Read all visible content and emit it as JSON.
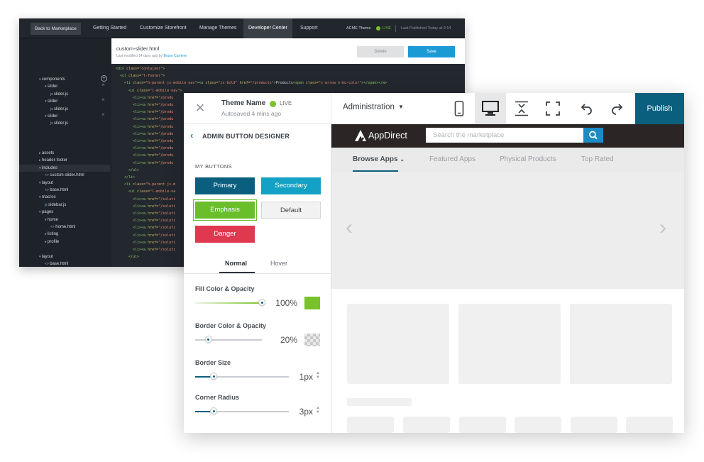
{
  "dev_center": {
    "back_button": "Back to Marketplace",
    "nav": [
      "Getting Started",
      "Customize Storefront",
      "Manage Themes",
      "Developer Center",
      "Support"
    ],
    "active_nav": "Developer Center",
    "theme_name": "ACME Theme",
    "live_label": "LIVE",
    "published": "Last Published Today at 2:14",
    "file": {
      "name": "custom-slider.html",
      "meta_prefix": "Last modified 14 days ago by ",
      "author": "Bruno Carriere",
      "delete_label": "Delete",
      "save_label": "Save"
    },
    "tree": [
      {
        "label": "components",
        "indent": 1,
        "kind": "folder",
        "plus": true
      },
      {
        "label": "slider",
        "indent": 2,
        "kind": "folder",
        "close": true
      },
      {
        "label": "slider.js",
        "indent": 3,
        "kind": "js"
      },
      {
        "label": "slider",
        "indent": 2,
        "kind": "folder",
        "close": true
      },
      {
        "label": "slider.js",
        "indent": 3,
        "kind": "js"
      },
      {
        "label": "slider",
        "indent": 2,
        "kind": "folder",
        "close": true
      },
      {
        "label": "slider.js",
        "indent": 3,
        "kind": "js"
      },
      {
        "label": "",
        "indent": 0,
        "kind": "gap"
      },
      {
        "label": "",
        "indent": 0,
        "kind": "gap"
      },
      {
        "label": "",
        "indent": 0,
        "kind": "gap"
      },
      {
        "label": "assets",
        "indent": 1,
        "kind": "folder-closed"
      },
      {
        "label": "header-footer",
        "indent": 1,
        "kind": "folder-closed"
      },
      {
        "label": "includes",
        "indent": 1,
        "kind": "folder",
        "selected": true
      },
      {
        "label": "custom-slider.html",
        "indent": 2,
        "kind": "html"
      },
      {
        "label": "layout",
        "indent": 1,
        "kind": "folder"
      },
      {
        "label": "base.html",
        "indent": 2,
        "kind": "html"
      },
      {
        "label": "macros",
        "indent": 1,
        "kind": "folder"
      },
      {
        "label": "sidebar.js",
        "indent": 2,
        "kind": "js"
      },
      {
        "label": "pages",
        "indent": 1,
        "kind": "folder"
      },
      {
        "label": "home",
        "indent": 2,
        "kind": "folder"
      },
      {
        "label": "home.html",
        "indent": 3,
        "kind": "html"
      },
      {
        "label": "listing",
        "indent": 2,
        "kind": "folder-closed"
      },
      {
        "label": "profile",
        "indent": 2,
        "kind": "folder-closed"
      },
      {
        "label": "",
        "indent": 0,
        "kind": "gap"
      },
      {
        "label": "layout",
        "indent": 1,
        "kind": "folder"
      },
      {
        "label": "base.html",
        "indent": 2,
        "kind": "html"
      },
      {
        "label": "macros",
        "indent": 1,
        "kind": "folder"
      },
      {
        "label": "sidebar.js",
        "indent": 2,
        "kind": "js"
      }
    ],
    "code": [
      {
        "indent": 0,
        "segs": [
          [
            "tag",
            "<div "
          ],
          [
            "attr",
            "class="
          ],
          [
            "str",
            "\"container\""
          ],
          [
            "tag",
            ">"
          ]
        ]
      },
      {
        "indent": 1,
        "segs": [
          [
            "tag",
            "<ul "
          ],
          [
            "attr",
            "class="
          ],
          [
            "str",
            "\"l-footer\""
          ],
          [
            "tag",
            ">"
          ]
        ]
      },
      {
        "indent": 2,
        "segs": [
          [
            "tag",
            "<li "
          ],
          [
            "attr",
            "class="
          ],
          [
            "str",
            "\"h-parent js-mobile-nav\""
          ],
          [
            "tag",
            "><a "
          ],
          [
            "attr",
            "class="
          ],
          [
            "str",
            "\"is-bold\""
          ],
          [
            "attr",
            " href="
          ],
          [
            "str",
            "\"/products\""
          ],
          [
            "tag",
            ">"
          ],
          [
            "txt",
            "Products"
          ],
          [
            "tag",
            "<span "
          ],
          [
            "attr",
            "class="
          ],
          [
            "str",
            "\"c-arrow h-bu-color\""
          ],
          [
            "tag",
            "></span></a>"
          ]
        ]
      },
      {
        "indent": 3,
        "segs": [
          [
            "tag",
            "<ul "
          ],
          [
            "attr",
            "class="
          ],
          [
            "str",
            "\"l-mobile-nav\""
          ],
          [
            "tag",
            ">"
          ]
        ]
      },
      {
        "indent": 4,
        "segs": [
          [
            "tag",
            "<li><a "
          ],
          [
            "attr",
            "href="
          ],
          [
            "str",
            "\"/produ"
          ]
        ]
      },
      {
        "indent": 4,
        "segs": [
          [
            "tag",
            "<li><a "
          ],
          [
            "attr",
            "href="
          ],
          [
            "str",
            "\"/produ"
          ]
        ]
      },
      {
        "indent": 4,
        "segs": [
          [
            "tag",
            "<li><a "
          ],
          [
            "attr",
            "href="
          ],
          [
            "str",
            "\"/produ"
          ]
        ]
      },
      {
        "indent": 4,
        "segs": [
          [
            "tag",
            "<li><a "
          ],
          [
            "attr",
            "href="
          ],
          [
            "str",
            "\"/produ"
          ]
        ]
      },
      {
        "indent": 4,
        "segs": [
          [
            "tag",
            "<li><a "
          ],
          [
            "attr",
            "href="
          ],
          [
            "str",
            "\"/produ"
          ]
        ]
      },
      {
        "indent": 4,
        "segs": [
          [
            "tag",
            "<li><a "
          ],
          [
            "attr",
            "href="
          ],
          [
            "str",
            "\"/produ"
          ]
        ]
      },
      {
        "indent": 4,
        "segs": [
          [
            "tag",
            "<li><a "
          ],
          [
            "attr",
            "href="
          ],
          [
            "str",
            "\"/produ"
          ]
        ]
      },
      {
        "indent": 4,
        "segs": [
          [
            "tag",
            "<li><a "
          ],
          [
            "attr",
            "href="
          ],
          [
            "str",
            "\"/produ"
          ]
        ]
      },
      {
        "indent": 4,
        "segs": [
          [
            "tag",
            "<li><a "
          ],
          [
            "attr",
            "href="
          ],
          [
            "str",
            "\"/produ"
          ]
        ]
      },
      {
        "indent": 4,
        "segs": [
          [
            "tag",
            "<li><a "
          ],
          [
            "attr",
            "href="
          ],
          [
            "str",
            "\"/produ"
          ]
        ]
      },
      {
        "indent": 3,
        "segs": [
          [
            "tag",
            "</ul>"
          ]
        ]
      },
      {
        "indent": 2,
        "segs": [
          [
            "tag",
            "</li>"
          ]
        ]
      },
      {
        "indent": 2,
        "segs": [
          [
            "tag",
            "<li "
          ],
          [
            "attr",
            "class="
          ],
          [
            "str",
            "\"h-parent js-m"
          ]
        ]
      },
      {
        "indent": 3,
        "segs": [
          [
            "tag",
            "<ul "
          ],
          [
            "attr",
            "class="
          ],
          [
            "str",
            "\"l-mobile-na"
          ]
        ]
      },
      {
        "indent": 4,
        "segs": [
          [
            "tag",
            "<li><a "
          ],
          [
            "attr",
            "href="
          ],
          [
            "str",
            "\"/soluti"
          ]
        ]
      },
      {
        "indent": 4,
        "segs": [
          [
            "tag",
            "<li><a "
          ],
          [
            "attr",
            "href="
          ],
          [
            "str",
            "\"/soluti"
          ]
        ]
      },
      {
        "indent": 4,
        "segs": [
          [
            "tag",
            "<li><a "
          ],
          [
            "attr",
            "href="
          ],
          [
            "str",
            "\"/soluti"
          ]
        ]
      },
      {
        "indent": 4,
        "segs": [
          [
            "tag",
            "<li><a "
          ],
          [
            "attr",
            "href="
          ],
          [
            "str",
            "\"/soluti"
          ]
        ]
      },
      {
        "indent": 4,
        "segs": [
          [
            "tag",
            "<li><a "
          ],
          [
            "attr",
            "href="
          ],
          [
            "str",
            "\"/soluti"
          ]
        ]
      },
      {
        "indent": 4,
        "segs": [
          [
            "tag",
            "<li><a "
          ],
          [
            "attr",
            "href="
          ],
          [
            "str",
            "\"/soluti"
          ]
        ]
      },
      {
        "indent": 4,
        "segs": [
          [
            "tag",
            "<li><a "
          ],
          [
            "attr",
            "href="
          ],
          [
            "str",
            "\"/soluti"
          ]
        ]
      },
      {
        "indent": 4,
        "segs": [
          [
            "tag",
            "<li><a "
          ],
          [
            "attr",
            "href="
          ],
          [
            "str",
            "\"/soluti"
          ]
        ]
      },
      {
        "indent": 3,
        "segs": [
          [
            "tag",
            "</ul>"
          ]
        ]
      }
    ]
  },
  "editor": {
    "theme_name": "Theme Name",
    "live_label": "LIVE",
    "autosaved": "Autosaved 4 mins ago",
    "view_select": "Administration",
    "publish_label": "Publish",
    "panel": {
      "title": "ADMIN BUTTON DESIGNER",
      "section": "MY BUTTONS",
      "buttons": {
        "primary": "Primary",
        "secondary": "Secondary",
        "emphasis": "Emphasis",
        "default": "Default",
        "danger": "Danger"
      },
      "state_tabs": [
        "Normal",
        "Hover"
      ],
      "fill": {
        "label": "Fill Color & Opacity",
        "value": "100%",
        "level": 1.0,
        "color": "#79c22b"
      },
      "border_color": {
        "label": "Border Color & Opacity",
        "value": "20%",
        "level": 0.2
      },
      "border_size": {
        "label": "Border Size",
        "value": "1px",
        "level": 0.2
      },
      "corner_radius": {
        "label": "Corner Radius",
        "value": "3px",
        "level": 0.2
      }
    },
    "preview": {
      "brand": "AppDirect",
      "search_placeholder": "Search the marketplace",
      "tabs": [
        "Browse Apps",
        "Featured Apps",
        "Physical Products",
        "Top Rated"
      ]
    }
  },
  "colors": {
    "brand_dark": "#0b5f7e",
    "secondary": "#14a1c6",
    "emphasis": "#69be2a",
    "danger": "#e0384f",
    "live": "#79c22b",
    "link": "#1b9ad6"
  }
}
